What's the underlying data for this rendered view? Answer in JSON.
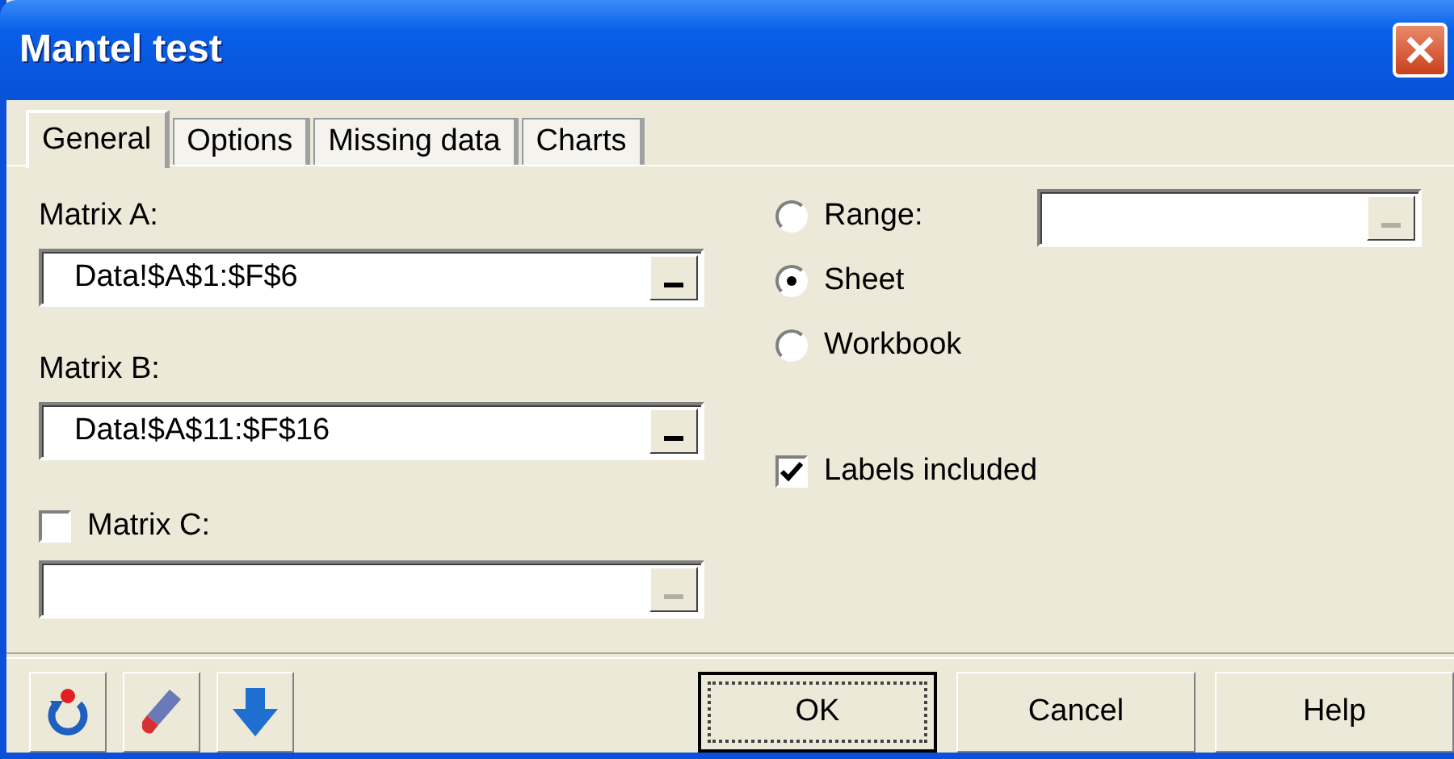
{
  "window": {
    "title": "Mantel test"
  },
  "tabs": [
    {
      "label": "General",
      "selected": true
    },
    {
      "label": "Options",
      "selected": false
    },
    {
      "label": "Missing data",
      "selected": false
    },
    {
      "label": "Charts",
      "selected": false
    }
  ],
  "matrix_a": {
    "label": "Matrix A:",
    "value": "Data!$A$1:$F$6"
  },
  "matrix_b": {
    "label": "Matrix B:",
    "value": "Data!$A$11:$F$16"
  },
  "matrix_c": {
    "label": "Matrix C:",
    "checked": false
  },
  "range_options": [
    {
      "label": "Range:",
      "selected": false
    },
    {
      "label": "Sheet",
      "selected": true
    },
    {
      "label": "Workbook",
      "selected": false
    }
  ],
  "labels_included": {
    "label": "Labels included",
    "checked": true
  },
  "buttons": [
    {
      "label": "OK",
      "default": true
    },
    {
      "label": "Cancel",
      "default": false
    },
    {
      "label": "Help",
      "default": false
    }
  ]
}
